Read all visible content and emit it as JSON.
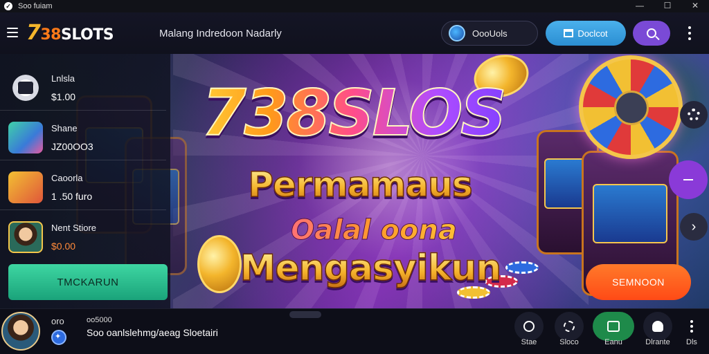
{
  "window": {
    "title": "Soo fuiam",
    "controls": {
      "minimize": "—",
      "maximize": "☐",
      "close": "✕"
    }
  },
  "header": {
    "logo": {
      "seven": "7",
      "thirtyeight": "38",
      "slots": "SLOTS"
    },
    "nav_link": "Malang Indredoon  Nadarly",
    "balance_label": "OooUols",
    "deposit_label": "Doclcot",
    "search_icon": "search-icon",
    "menu_icon": "more-vertical-icon"
  },
  "sidebar": {
    "items": [
      {
        "name": "Lnlsla",
        "value": "$1.00",
        "icon": "dq-icon"
      },
      {
        "name": "Shane",
        "value": "JZ00OO3",
        "icon": "gift-icon"
      },
      {
        "name": "Caoorla",
        "value": "1 .50 furo",
        "icon": "guitar-icon"
      },
      {
        "name": "Nent Stiore",
        "value": "$0.00",
        "icon": "avatar"
      }
    ],
    "cta_label": "TMCKARUN"
  },
  "hero": {
    "brand_text": "738SLOS",
    "subtitle": "Permamaus",
    "line3": "Oalal oona",
    "line4": "Mengasyikun",
    "cta_right": "SEMNOON"
  },
  "bottom_bar": {
    "username": "oro",
    "small_text": "oo5000",
    "message": "Soo oanlslehmg/aeag Sloetairi",
    "nav": [
      {
        "label": "Stae",
        "icon": "chat-icon"
      },
      {
        "label": "Sloco",
        "icon": "chips-icon"
      },
      {
        "label": "Eanu",
        "icon": "game-icon",
        "active": true
      },
      {
        "label": "Dlrante",
        "icon": "user-icon"
      },
      {
        "label": "Dls",
        "icon": "more-icon"
      }
    ]
  },
  "colors": {
    "accent_green": "#1aa37a",
    "accent_blue": "#2b8ed2",
    "accent_purple": "#7a4ad6",
    "accent_orange": "#ff4a16",
    "background": "#0d0e18"
  }
}
